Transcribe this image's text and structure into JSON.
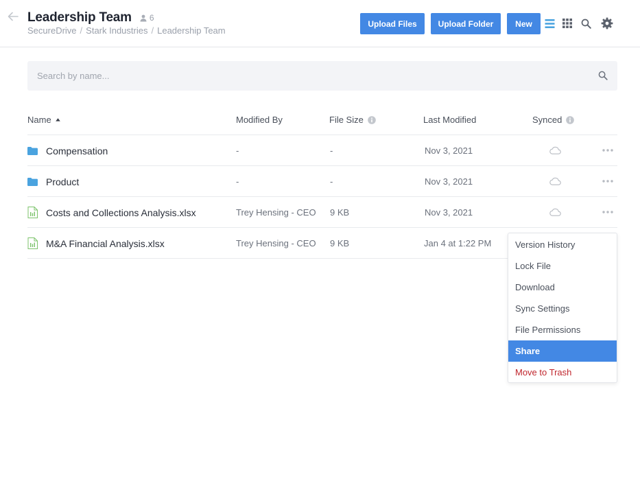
{
  "header": {
    "title": "Leadership Team",
    "member_count": "6",
    "breadcrumb": [
      "SecureDrive",
      "Stark Industries",
      "Leadership Team"
    ],
    "buttons": {
      "upload_files": "Upload Files",
      "upload_folder": "Upload Folder",
      "new": "New"
    },
    "icons": [
      "back-arrow-icon",
      "list-view-icon",
      "grid-view-icon",
      "search-icon",
      "gear-icon"
    ]
  },
  "search": {
    "placeholder": "Search by name...",
    "value": ""
  },
  "table": {
    "columns": {
      "name": "Name",
      "modified_by": "Modified By",
      "file_size": "File Size",
      "last_modified": "Last Modified",
      "synced": "Synced"
    },
    "sort": {
      "column": "name",
      "direction": "ascending"
    },
    "rows": [
      {
        "type": "folder",
        "name": "Compensation",
        "modified_by": "-",
        "file_size": "-",
        "last_modified": "Nov 3, 2021",
        "synced": "cloud-icon"
      },
      {
        "type": "folder",
        "name": "Product",
        "modified_by": "-",
        "file_size": "-",
        "last_modified": "Nov 3, 2021",
        "synced": "cloud-icon"
      },
      {
        "type": "spreadsheet",
        "name": "Costs and Collections Analysis.xlsx",
        "modified_by": "Trey Hensing - CEO",
        "file_size": "9 KB",
        "last_modified": "Nov 3, 2021",
        "synced": "cloud-icon"
      },
      {
        "type": "spreadsheet",
        "name": "M&A Financial Analysis.xlsx",
        "modified_by": "Trey Hensing - CEO",
        "file_size": "9 KB",
        "last_modified": "Jan 4 at 1:22 PM",
        "synced": ""
      }
    ]
  },
  "context_menu": {
    "items": [
      {
        "label": "Version History"
      },
      {
        "label": "Lock File"
      },
      {
        "label": "Download"
      },
      {
        "label": "Sync Settings"
      },
      {
        "label": "File Permissions"
      },
      {
        "label": "Share",
        "state": "highlighted"
      },
      {
        "label": "Move to Trash",
        "style": "danger"
      }
    ]
  },
  "colors": {
    "accent": "#4388e4",
    "folder": "#4aa3df",
    "spreadsheet": "#7cc36b",
    "danger": "#c0262d",
    "muted": "#9aa0ab"
  }
}
